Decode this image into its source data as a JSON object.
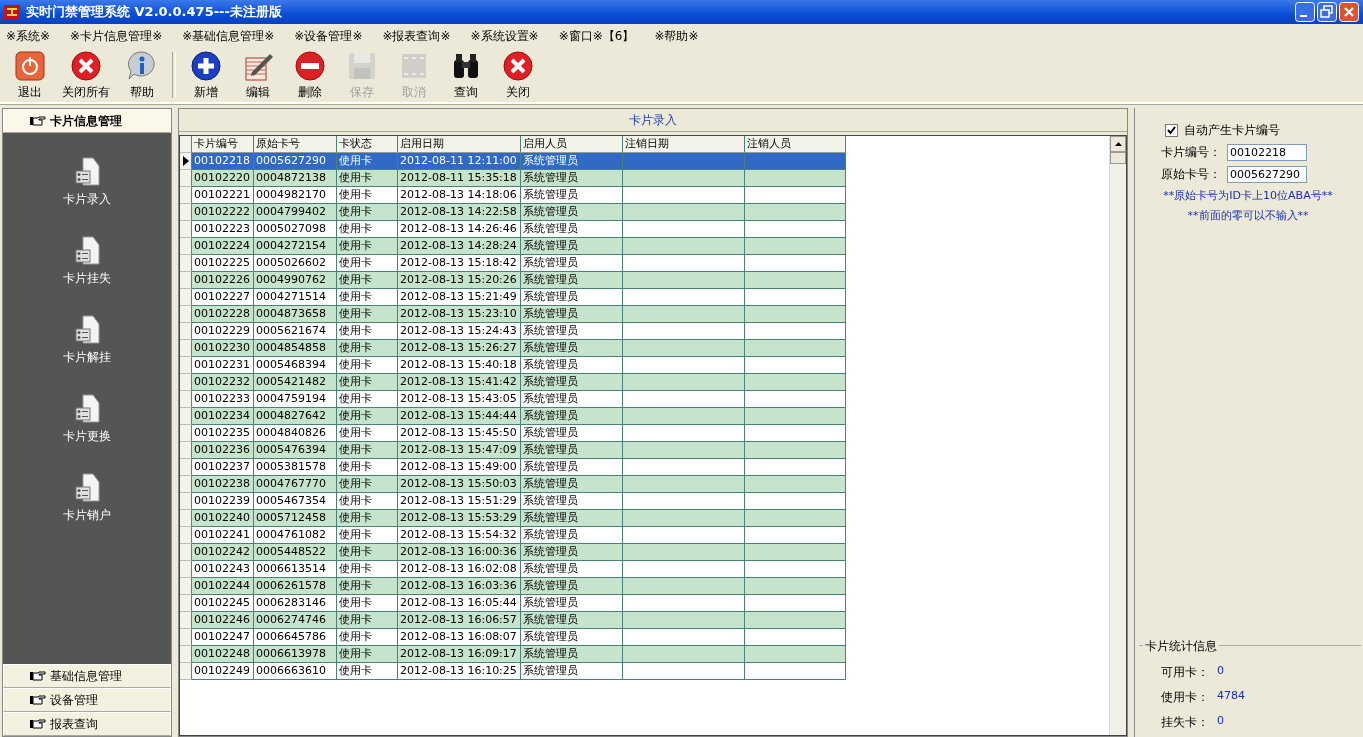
{
  "window": {
    "title": "实时门禁管理系统 V2.0.0.475---未注册版"
  },
  "menu": [
    "※系统※",
    "※卡片信息管理※",
    "※基础信息管理※",
    "※设备管理※",
    "※报表查询※",
    "※系统设置※",
    "※窗口※【6】",
    "※帮助※"
  ],
  "toolbar": [
    [
      {
        "label": "退出",
        "kind": "exit",
        "disabled": false
      },
      {
        "label": "关闭所有",
        "kind": "close",
        "disabled": false
      },
      {
        "label": "帮助",
        "kind": "help",
        "disabled": false
      }
    ],
    [
      {
        "label": "新增",
        "kind": "add",
        "disabled": false
      },
      {
        "label": "编辑",
        "kind": "edit",
        "disabled": false
      },
      {
        "label": "删除",
        "kind": "delete",
        "disabled": false
      },
      {
        "label": "保存",
        "kind": "save",
        "disabled": true
      },
      {
        "label": "取消",
        "kind": "cancel",
        "disabled": true
      },
      {
        "label": "查询",
        "kind": "search",
        "disabled": false
      },
      {
        "label": "关闭",
        "kind": "close",
        "disabled": false
      }
    ]
  ],
  "sidebar": [
    {
      "label": "卡片信息管理",
      "expanded": true,
      "items": [
        "卡片录入",
        "卡片挂失",
        "卡片解挂",
        "卡片更换",
        "卡片销户"
      ]
    },
    {
      "label": "基础信息管理",
      "expanded": false
    },
    {
      "label": "设备管理",
      "expanded": false
    },
    {
      "label": "报表查询",
      "expanded": false
    }
  ],
  "panel": {
    "title": "卡片录入"
  },
  "table": {
    "columns": [
      "卡片编号",
      "原始卡号",
      "卡状态",
      "启用日期",
      "启用人员",
      "注销日期",
      "注销人员"
    ],
    "rows": [
      {
        "cells": [
          "00102218",
          "0005627290",
          "使用卡",
          "2012-08-11 12:11:00",
          "系统管理员"
        ],
        "selected": true
      },
      {
        "cells": [
          "00102220",
          "0004872138",
          "使用卡",
          "2012-08-11 15:35:18",
          "系统管理员"
        ],
        "selected": false
      },
      {
        "cells": [
          "00102221",
          "0004982170",
          "使用卡",
          "2012-08-13 14:18:06",
          "系统管理员"
        ],
        "selected": false
      },
      {
        "cells": [
          "00102222",
          "0004799402",
          "使用卡",
          "2012-08-13 14:22:58",
          "系统管理员"
        ],
        "selected": false
      },
      {
        "cells": [
          "00102223",
          "0005027098",
          "使用卡",
          "2012-08-13 14:26:46",
          "系统管理员"
        ],
        "selected": false
      },
      {
        "cells": [
          "00102224",
          "0004272154",
          "使用卡",
          "2012-08-13 14:28:24",
          "系统管理员"
        ],
        "selected": false
      },
      {
        "cells": [
          "00102225",
          "0005026602",
          "使用卡",
          "2012-08-13 15:18:42",
          "系统管理员"
        ],
        "selected": false
      },
      {
        "cells": [
          "00102226",
          "0004990762",
          "使用卡",
          "2012-08-13 15:20:26",
          "系统管理员"
        ],
        "selected": false
      },
      {
        "cells": [
          "00102227",
          "0004271514",
          "使用卡",
          "2012-08-13 15:21:49",
          "系统管理员"
        ],
        "selected": false
      },
      {
        "cells": [
          "00102228",
          "0004873658",
          "使用卡",
          "2012-08-13 15:23:10",
          "系统管理员"
        ],
        "selected": false
      },
      {
        "cells": [
          "00102229",
          "0005621674",
          "使用卡",
          "2012-08-13 15:24:43",
          "系统管理员"
        ],
        "selected": false
      },
      {
        "cells": [
          "00102230",
          "0004854858",
          "使用卡",
          "2012-08-13 15:26:27",
          "系统管理员"
        ],
        "selected": false
      },
      {
        "cells": [
          "00102231",
          "0005468394",
          "使用卡",
          "2012-08-13 15:40:18",
          "系统管理员"
        ],
        "selected": false
      },
      {
        "cells": [
          "00102232",
          "0005421482",
          "使用卡",
          "2012-08-13 15:41:42",
          "系统管理员"
        ],
        "selected": false
      },
      {
        "cells": [
          "00102233",
          "0004759194",
          "使用卡",
          "2012-08-13 15:43:05",
          "系统管理员"
        ],
        "selected": false
      },
      {
        "cells": [
          "00102234",
          "0004827642",
          "使用卡",
          "2012-08-13 15:44:44",
          "系统管理员"
        ],
        "selected": false
      },
      {
        "cells": [
          "00102235",
          "0004840826",
          "使用卡",
          "2012-08-13 15:45:50",
          "系统管理员"
        ],
        "selected": false
      },
      {
        "cells": [
          "00102236",
          "0005476394",
          "使用卡",
          "2012-08-13 15:47:09",
          "系统管理员"
        ],
        "selected": false
      },
      {
        "cells": [
          "00102237",
          "0005381578",
          "使用卡",
          "2012-08-13 15:49:00",
          "系统管理员"
        ],
        "selected": false
      },
      {
        "cells": [
          "00102238",
          "0004767770",
          "使用卡",
          "2012-08-13 15:50:03",
          "系统管理员"
        ],
        "selected": false
      },
      {
        "cells": [
          "00102239",
          "0005467354",
          "使用卡",
          "2012-08-13 15:51:29",
          "系统管理员"
        ],
        "selected": false
      },
      {
        "cells": [
          "00102240",
          "0005712458",
          "使用卡",
          "2012-08-13 15:53:29",
          "系统管理员"
        ],
        "selected": false
      },
      {
        "cells": [
          "00102241",
          "0004761082",
          "使用卡",
          "2012-08-13 15:54:32",
          "系统管理员"
        ],
        "selected": false
      },
      {
        "cells": [
          "00102242",
          "0005448522",
          "使用卡",
          "2012-08-13 16:00:36",
          "系统管理员"
        ],
        "selected": false
      },
      {
        "cells": [
          "00102243",
          "0006613514",
          "使用卡",
          "2012-08-13 16:02:08",
          "系统管理员"
        ],
        "selected": false
      },
      {
        "cells": [
          "00102244",
          "0006261578",
          "使用卡",
          "2012-08-13 16:03:36",
          "系统管理员"
        ],
        "selected": false
      },
      {
        "cells": [
          "00102245",
          "0006283146",
          "使用卡",
          "2012-08-13 16:05:44",
          "系统管理员"
        ],
        "selected": false
      },
      {
        "cells": [
          "00102246",
          "0006274746",
          "使用卡",
          "2012-08-13 16:06:57",
          "系统管理员"
        ],
        "selected": false
      },
      {
        "cells": [
          "00102247",
          "0006645786",
          "使用卡",
          "2012-08-13 16:08:07",
          "系统管理员"
        ],
        "selected": false
      },
      {
        "cells": [
          "00102248",
          "0006613978",
          "使用卡",
          "2012-08-13 16:09:17",
          "系统管理员"
        ],
        "selected": false
      },
      {
        "cells": [
          "00102249",
          "0006663610",
          "使用卡",
          "2012-08-13 16:10:25",
          "系统管理员"
        ],
        "selected": false
      }
    ]
  },
  "form": {
    "auto_number": {
      "label": "自动产生卡片编号",
      "checked": true
    },
    "fields": [
      {
        "label": "卡片编号：",
        "value": "00102218"
      },
      {
        "label": "原始卡号：",
        "value": "0005627290"
      }
    ],
    "notes": [
      "**原始卡号为ID卡上10位ABA号**",
      "**前面的零可以不输入**"
    ]
  },
  "stats": {
    "title": "卡片统计信息",
    "rows": [
      {
        "label": "可用卡：",
        "value": "0"
      },
      {
        "label": "使用卡：",
        "value": "4784"
      },
      {
        "label": "挂失卡：",
        "value": "0"
      }
    ]
  }
}
